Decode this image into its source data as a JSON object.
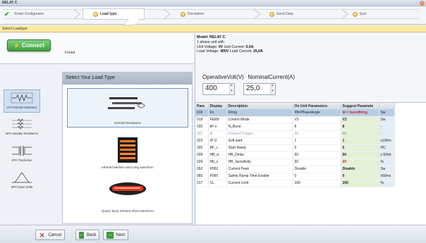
{
  "window": {
    "title": "RELAY C"
  },
  "wizard": {
    "steps": [
      {
        "label": "Smart Configurator",
        "state": "done"
      },
      {
        "label": "Load type",
        "state": "active"
      },
      {
        "label": "Disclaimer",
        "state": "pending"
      },
      {
        "label": "Send Data",
        "state": "pending"
      },
      {
        "label": "End",
        "state": "pending"
      }
    ]
  },
  "subbar": {
    "title": "Select Loadtype"
  },
  "connection": {
    "button_label": "Connect",
    "status": "Found"
  },
  "device": {
    "model": "Model: RELAY C",
    "line1": "1 phase unit with",
    "unit_voltage_label": "Unit Voltage:",
    "unit_voltage": "0V",
    "unit_current_label": "Unit Current:",
    "unit_current": "0,0A",
    "load_voltage_label": "Load Voltage:",
    "load_voltage": "400V",
    "load_current_label": "Load Current:",
    "load_current": "25,0A"
  },
  "load_categories": [
    {
      "label": "1PH Normal resistance",
      "selected": true
    },
    {
      "label": "3PH Variable Resistance",
      "selected": false
    },
    {
      "label": "1PH Tranformer",
      "selected": false
    },
    {
      "label": "3PH Open Delta",
      "selected": false
    }
  ],
  "load_types": {
    "header": "Select Your Load Type",
    "items": [
      {
        "label": "Normal Resistance",
        "selected": true
      },
      {
        "label": "Infrared Medium and Long waveform",
        "selected": false
      },
      {
        "label": "Quartz lamp Infrared Short waveform",
        "selected": false
      }
    ]
  },
  "operative": {
    "volt_label": "OperativeVolt(V)",
    "volt_value": "400",
    "current_label": "NominalCurrent(A)",
    "current_value": "25,0"
  },
  "params_table": {
    "headers": [
      "Para",
      "Display",
      "Description",
      "On Unit Parameters",
      "Suggest Paramete",
      ""
    ],
    "rows": [
      {
        "cells": [
          "018",
          "Fir",
          "Firing",
          "PA=PhaseAngle",
          "bt = burstfiring",
          "Sw"
        ],
        "selected": true,
        "dim": false,
        "red": true
      },
      {
        "cells": [
          "019",
          "FEEB",
          "Control Mode",
          "V2",
          "V2",
          "Sw"
        ],
        "selected": false,
        "dim": false,
        "red": false
      },
      {
        "cells": [
          "020",
          "bF n",
          "N_Burst",
          "8",
          "8",
          "-"
        ],
        "selected": false,
        "dim": false,
        "red": false
      },
      {
        "cells": [
          "022",
          "dt",
          "Delayed Trigger",
          "45",
          "45",
          "°"
        ],
        "selected": false,
        "dim": true,
        "red": false
      },
      {
        "cells": [
          "023",
          "rP U",
          "Soft start",
          "1",
          "1",
          "x100m"
        ],
        "selected": false,
        "dim": false,
        "red": false
      },
      {
        "cells": [
          "025",
          "BF_r",
          "Start Ramp",
          "0",
          "0",
          "HC"
        ],
        "selected": false,
        "dim": false,
        "red": false
      },
      {
        "cells": [
          "028",
          "HB_d",
          "HB_Delay",
          "50",
          "50",
          "x 50mt"
        ],
        "selected": false,
        "dim": false,
        "red": false
      },
      {
        "cells": [
          "029",
          "Hb_s",
          "HB_Sensitivity",
          "50",
          "20",
          "%"
        ],
        "selected": false,
        "dim": false,
        "red": true
      },
      {
        "cells": [
          "052",
          "P052",
          "Current Peak",
          "Disable",
          "Disable",
          "Sw"
        ],
        "selected": false,
        "dim": false,
        "red": false
      },
      {
        "cells": [
          "065",
          "P065",
          "Safety Ramp Time Enable",
          "0",
          "0",
          "x50ms"
        ],
        "selected": false,
        "dim": false,
        "red": false
      },
      {
        "cells": [
          "017",
          "CL",
          "Current Limit",
          "100",
          "100",
          "%"
        ],
        "selected": false,
        "dim": false,
        "red": false
      }
    ]
  },
  "footer": {
    "cancel": "Cancel",
    "back": "Back",
    "next": "Next"
  },
  "colors": {
    "accent_green": "#3d9a3a",
    "highlight_yellow": "#fde9a4",
    "selection_blue": "#b8cde6",
    "warning_red": "#d0241b"
  }
}
